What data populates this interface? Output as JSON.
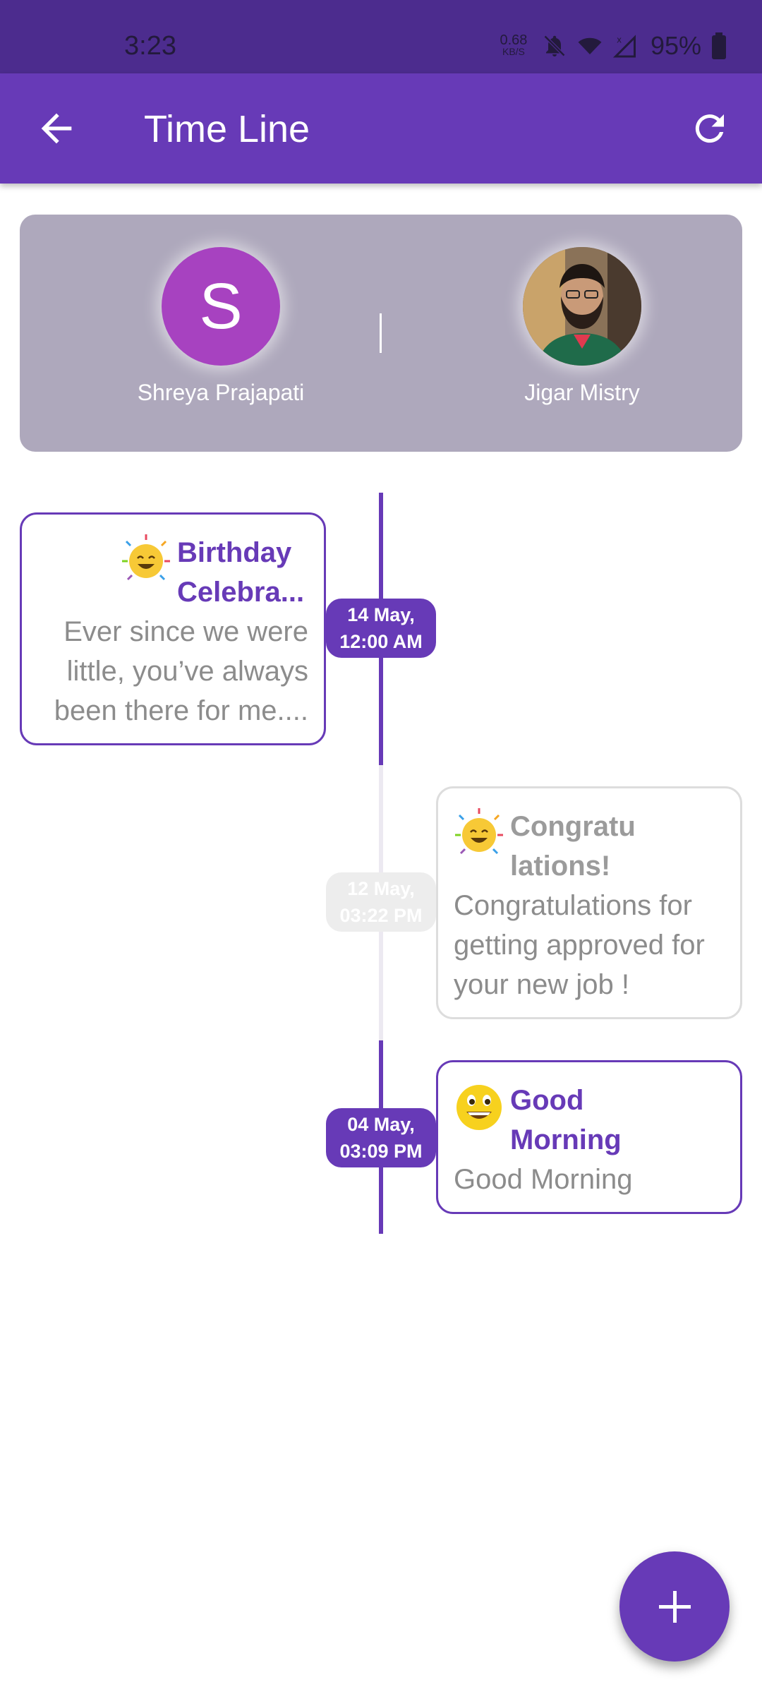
{
  "status_bar": {
    "time": "3:23",
    "net_speed_value": "0.68",
    "net_speed_unit": "KB/S",
    "battery": "95%",
    "icons": [
      "bell-off-icon",
      "wifi-icon",
      "signal-icon",
      "battery-icon"
    ]
  },
  "app_bar": {
    "title": "Time Line",
    "back_icon": "arrow-left-icon",
    "refresh_icon": "refresh-icon"
  },
  "profiles": {
    "left": {
      "initial": "S",
      "name": "Shreya Prajapati"
    },
    "right": {
      "name": "Jigar Mistry"
    }
  },
  "events": [
    {
      "title_line1": "Birthday",
      "title_line2": "Celebra...",
      "body_lines": [
        "Ever since we were",
        "little, you’ve always",
        "been there for me...."
      ],
      "date_line1": "14 May,",
      "date_line2": "12:00 AM",
      "emoji": "party-face-icon"
    },
    {
      "title_line1": "Congratu",
      "title_line2": "lations!",
      "body_lines": [
        "Congratulations for",
        "getting approved for",
        "your new job !"
      ],
      "date_line1": "12 May,",
      "date_line2": "03:22 PM",
      "emoji": "party-face-icon"
    },
    {
      "title_line1": "Good",
      "title_line2": "Morning",
      "body_lines": [
        "Good Morning"
      ],
      "date_line1": "04 May,",
      "date_line2": "03:09 PM",
      "emoji": "grinning-face-icon"
    }
  ],
  "fab": {
    "icon": "plus-icon"
  },
  "colors": {
    "primary": "#673ab7",
    "status_bar": "#4c2c8e",
    "profile_card": "#aea8bc",
    "avatar": "#a742c0"
  }
}
